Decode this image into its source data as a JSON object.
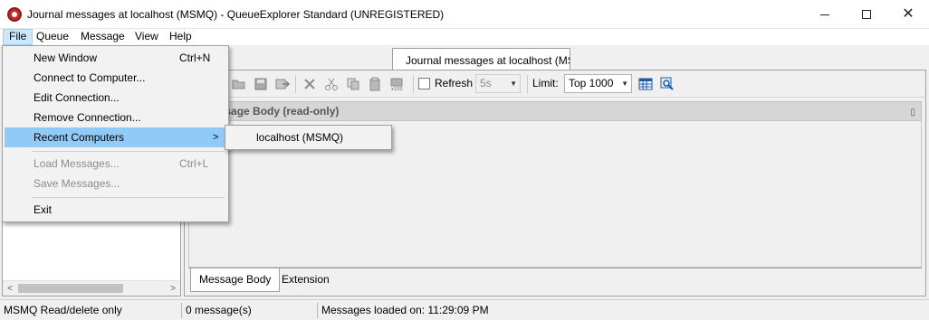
{
  "window": {
    "title": "Journal messages at localhost (MSMQ) - QueueExplorer Standard (UNREGISTERED)",
    "app_icon": "queueexplorer-app-icon",
    "controls": [
      "minimize-icon",
      "maximize-icon",
      "close-icon"
    ]
  },
  "menubar": {
    "items": [
      "File",
      "Queue",
      "Message",
      "View",
      "Help"
    ],
    "active": "File"
  },
  "file_menu": {
    "items": [
      {
        "label": "New Window",
        "shortcut": "Ctrl+N",
        "enabled": true
      },
      {
        "label": "Connect to Computer...",
        "shortcut": "",
        "enabled": true
      },
      {
        "label": "Edit Connection...",
        "shortcut": "",
        "enabled": true
      },
      {
        "label": "Remove Connection...",
        "shortcut": "",
        "enabled": true
      },
      {
        "label": "Recent Computers",
        "shortcut": "",
        "enabled": true,
        "submenu": true,
        "highlighted": true
      },
      {
        "label": "Load Messages...",
        "shortcut": "Ctrl+L",
        "enabled": false
      },
      {
        "label": "Save Messages...",
        "shortcut": "",
        "enabled": false
      },
      {
        "label": "Exit",
        "shortcut": "",
        "enabled": true
      }
    ],
    "submenu_arrow": "chevron-right-icon"
  },
  "recent_computers_submenu": {
    "items": [
      "localhost (MSMQ)"
    ]
  },
  "document_tab": {
    "label": "Journal messages at localhost (MSMQ)"
  },
  "toolbar": {
    "icons": [
      "open-icon",
      "save-icon",
      "forward-icon",
      "delete-icon",
      "cut-icon",
      "copy-icon",
      "paste-icon",
      "purge-icon"
    ],
    "refresh_label": "Refresh",
    "refresh_checked": false,
    "refresh_interval": "5s",
    "limit_label": "Limit:",
    "limit_value": "Top 1000",
    "extra_icons": [
      "columns-icon",
      "search-icon"
    ]
  },
  "message_panel": {
    "header": "Message Body (read-only)",
    "pin_icon": "pin-icon",
    "tabs": [
      "Message Body",
      "Extension"
    ],
    "active_tab": "Message Body"
  },
  "statusbar": {
    "mode": "MSMQ Read/delete only",
    "count": "0 message(s)",
    "loaded": "Messages loaded on: 11:29:09 PM"
  }
}
